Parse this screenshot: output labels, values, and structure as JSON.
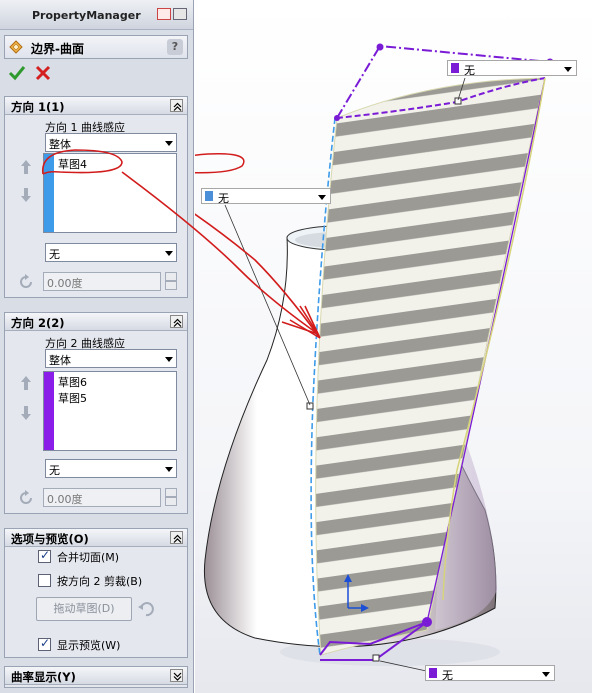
{
  "panel": {
    "title": "PropertyManager",
    "feature_title": "边界-曲面",
    "help_label": "?"
  },
  "direction1": {
    "header": "方向 1(1)",
    "curve_influence_label": "方向 1 曲线感应",
    "influence_value": "整体",
    "items": [
      "草图4"
    ],
    "tangency_value": "无",
    "angle_value": "0.00度",
    "bar_color": "#3d9be9"
  },
  "direction2": {
    "header": "方向 2(2)",
    "curve_influence_label": "方向 2 曲线感应",
    "influence_value": "整体",
    "items": [
      "草图6",
      "草图5"
    ],
    "tangency_value": "无",
    "angle_value": "0.00度",
    "bar_color": "#8b1de8"
  },
  "options": {
    "header": "选项与预览(O)",
    "merge_tangent": {
      "label": "合并切面(M)",
      "checked": true
    },
    "trim_dir2": {
      "label": "按方向 2 剪裁(B)",
      "checked": false
    },
    "drag_sketch_label": "拖动草图(D)",
    "show_preview": {
      "label": "显示预览(W)",
      "checked": true
    }
  },
  "curvature": {
    "header": "曲率显示(Y)"
  },
  "viewport": {
    "callout_top": {
      "value": "无",
      "color": "#7a1bd6"
    },
    "callout_left": {
      "value": "无",
      "color": "#4a8fd8"
    },
    "callout_bottom": {
      "value": "无",
      "color": "#7a1bd6"
    }
  },
  "icons": {
    "ok": "check-icon",
    "cancel": "x-icon",
    "feature": "boundary-surface-icon",
    "up": "arrow-up-icon",
    "down": "arrow-down-icon",
    "rotate": "reverse-direction-icon",
    "undo": "undo-icon"
  }
}
